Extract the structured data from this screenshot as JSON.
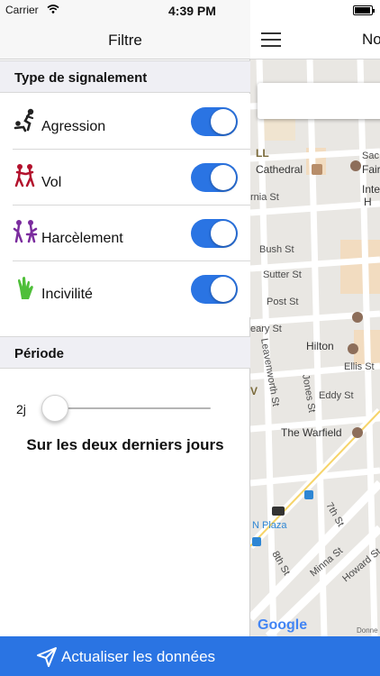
{
  "status_bar": {
    "carrier": "Carrier",
    "time": "4:39 PM"
  },
  "drawer": {
    "title": "Filtre",
    "sections": {
      "report_type": "Type de signalement",
      "period": "Période"
    },
    "filters": [
      {
        "label": "Agression",
        "icon": "agression-icon",
        "enabled": true
      },
      {
        "label": "Vol",
        "icon": "theft-icon",
        "enabled": true
      },
      {
        "label": "Harcèlement",
        "icon": "harassment-icon",
        "enabled": true
      },
      {
        "label": "Incivilité",
        "icon": "incivility-icon",
        "enabled": true
      }
    ],
    "period_slider": {
      "value_label": "2j",
      "position": 0
    },
    "period_description": "Sur les deux derniers jours",
    "refresh_button": "Actualiser les données"
  },
  "map": {
    "nav_title": "No",
    "labels": {
      "cathedral": "Cathedral",
      "fairmont": "Fair",
      "sac": "Sac",
      "inte": "Inte",
      "h": "H",
      "ll": "LL",
      "ornia": "rnia St",
      "bush": "Bush St",
      "sutter": "Sutter St",
      "post": "Post St",
      "geary": "eary St",
      "hilton": "Hilton",
      "leavenworth": "Leavenworth St",
      "jones": "Jones St",
      "ellis": "Ellis St",
      "eddy": "Eddy St",
      "warfield": "The Warfield",
      "nplaza": "N Plaza",
      "seventh": "7th St",
      "eighth": "8th St",
      "minna": "Minna St",
      "howard": "Howard St",
      "v": "V",
      "google": "Google",
      "donne": "Donne"
    }
  },
  "colors": {
    "accent": "#2a74e3",
    "map_bg": "#e9e7e3"
  }
}
